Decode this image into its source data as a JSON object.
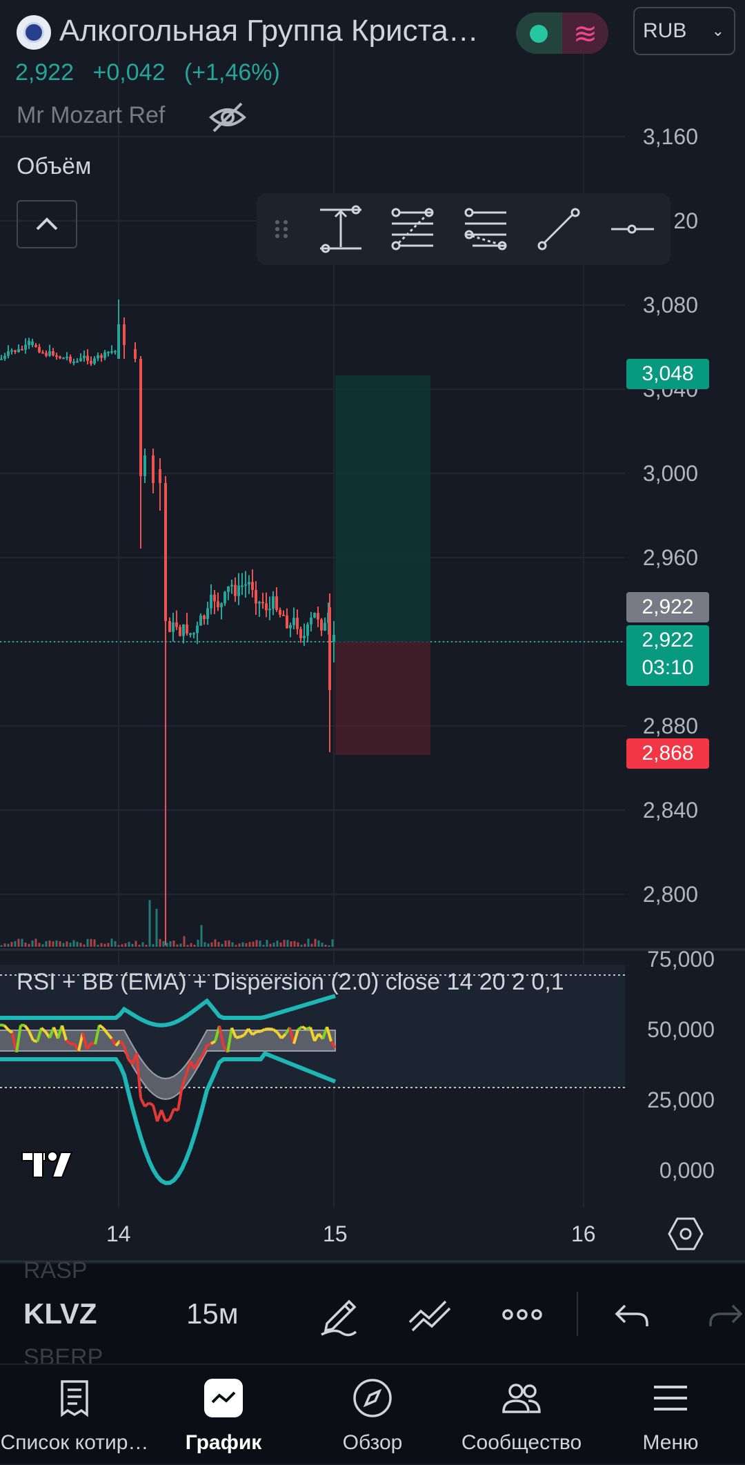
{
  "header": {
    "title": "Алкогольная Группа Криста…",
    "logo_icon": "company-emblem-icon",
    "currency": "RUB"
  },
  "quote": {
    "last": "2,922",
    "change": "+0,042",
    "change_pct": "(+1,46%)",
    "color": "#26a69a"
  },
  "indicators": {
    "top_indicator": "Mr Mozart Ref",
    "volume_label": "Объём",
    "rsi_label": "RSI + BB (EMA) + Dispersion (2.0) close 14 20 2 0,1"
  },
  "drawing_tools": [
    "ruler-icon",
    "fib-retracement-icon",
    "fib-extension-icon",
    "trend-line-icon",
    "horizontal-ray-icon"
  ],
  "price_axis": {
    "labels": [
      "3,160",
      "20",
      "3,080",
      "3,040",
      "3,000",
      "2,960",
      "2,880",
      "2,840",
      "2,800"
    ],
    "tags": {
      "target": "3,048",
      "current_grey": "2,922",
      "current": "2,922",
      "countdown": "03:10",
      "stop": "2,868"
    },
    "tag_colors": {
      "target": "#089981",
      "grey": "#787b86",
      "current": "#089981",
      "stop": "#f23645"
    }
  },
  "rsi_axis": {
    "labels": [
      "75,000",
      "50,000",
      "25,000",
      "0,000"
    ]
  },
  "time_axis": {
    "labels": [
      "14",
      "15",
      "16"
    ]
  },
  "toolbar": {
    "prev_symbol": "RASP",
    "symbol": "KLVZ",
    "next_symbol": "SBERP",
    "timeframe": "15м",
    "icons": [
      "pen-draw-icon",
      "indicators-icon",
      "more-icon",
      "undo-icon",
      "redo-icon"
    ]
  },
  "nav": {
    "items": [
      {
        "label": "Список котир…",
        "icon": "watchlist-icon"
      },
      {
        "label": "График",
        "icon": "chart-icon"
      },
      {
        "label": "Обзор",
        "icon": "compass-icon"
      },
      {
        "label": "Сообщество",
        "icon": "community-icon"
      },
      {
        "label": "Меню",
        "icon": "menu-icon"
      }
    ],
    "active": "График"
  }
}
